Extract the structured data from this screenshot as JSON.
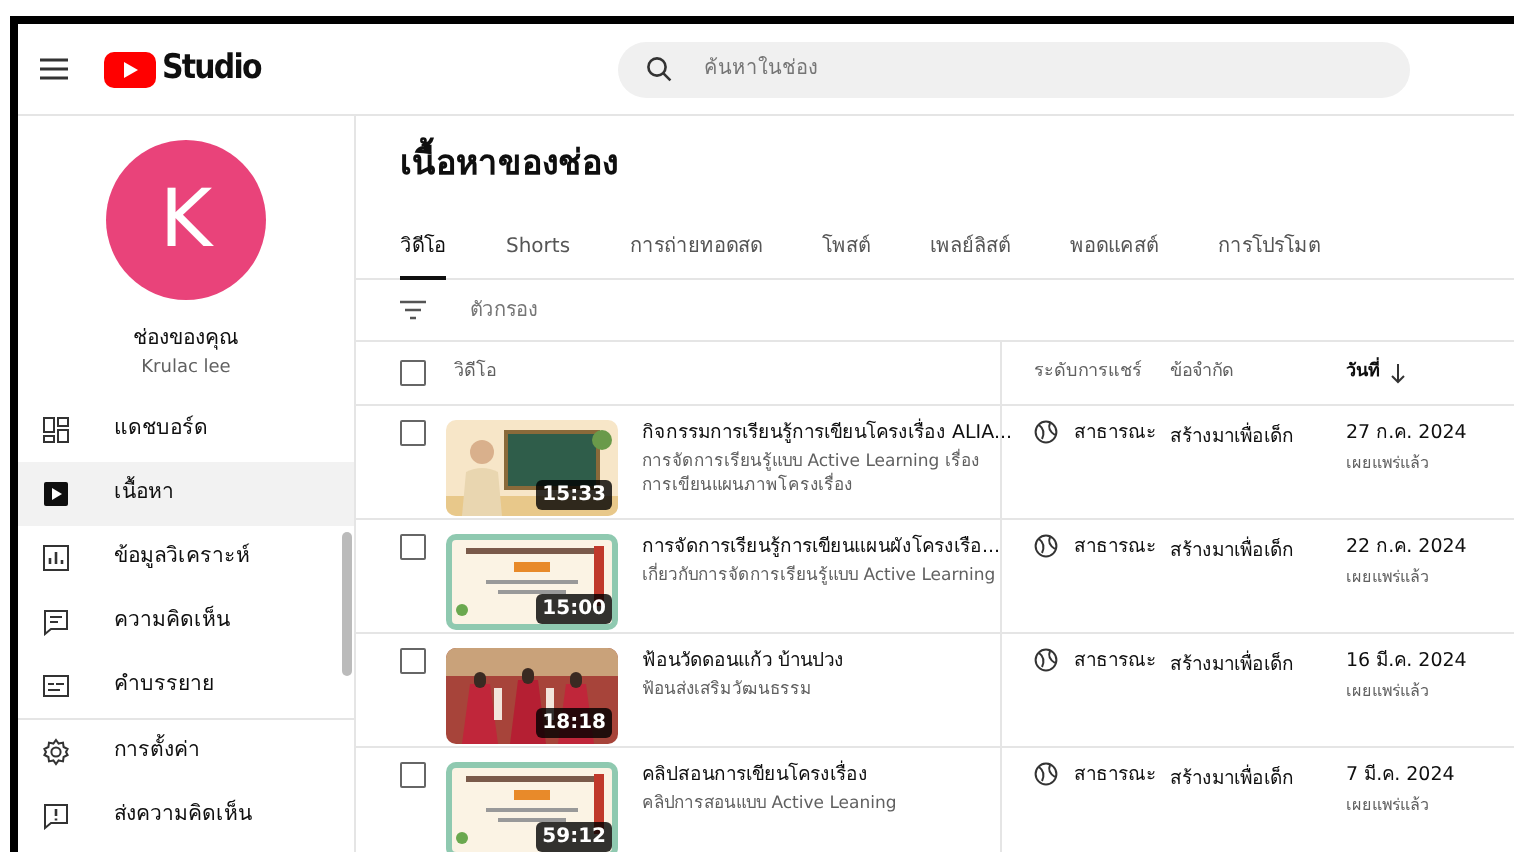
{
  "header": {
    "logo_text": "Studio",
    "search": {
      "placeholder": "ค้นหาในช่อง"
    }
  },
  "channel": {
    "avatar_letter": "K",
    "title": "ช่องของคุณ",
    "handle": "Krulac lee"
  },
  "sidebar": {
    "items": [
      {
        "label": "แดชบอร์ด",
        "selected": false
      },
      {
        "label": "เนื้อหา",
        "selected": true
      },
      {
        "label": "ข้อมูลวิเคราะห์",
        "selected": false
      },
      {
        "label": "ความคิดเห็น",
        "selected": false
      },
      {
        "label": "คำบรรยาย",
        "selected": false
      }
    ],
    "footer_items": [
      {
        "label": "การตั้งค่า"
      },
      {
        "label": "ส่งความคิดเห็น"
      }
    ]
  },
  "page_title": "เนื้อหาของช่อง",
  "tabs": [
    {
      "label": "วิดีโอ",
      "selected": true
    },
    {
      "label": "Shorts",
      "selected": false
    },
    {
      "label": "การถ่ายทอดสด",
      "selected": false
    },
    {
      "label": "โพสต์",
      "selected": false
    },
    {
      "label": "เพลย์ลิสต์",
      "selected": false
    },
    {
      "label": "พอดแคสต์",
      "selected": false
    },
    {
      "label": "การโปรโมต",
      "selected": false
    }
  ],
  "filter": {
    "placeholder": "ตัวกรอง"
  },
  "table": {
    "select_all_checked": false,
    "columns": [
      "วิดีโอ",
      "ระดับการแชร์",
      "ข้อจำกัด",
      "วันที่"
    ],
    "rows": [
      {
        "checked": false,
        "duration": "15:33",
        "title": "กิจกรรมการเรียนรู้การเขียนโครงเรื่อง ALIA...",
        "description": "การจัดการเรียนรู้แบบ Active Learning เรื่อง การเขียนแผนภาพโครงเรื่อง",
        "visibility": "สาธารณะ",
        "restriction": "สร้างมาเพื่อเด็ก",
        "date": "27 ก.ค. 2024",
        "status": "เผยแพร่แล้ว"
      },
      {
        "checked": false,
        "duration": "15:00",
        "title": "การจัดการเรียนรู้การเขียนแผนผังโครงเรือ...",
        "description": "เกี่ยวกับการจัดการเรียนรู้แบบ Active Learning",
        "visibility": "สาธารณะ",
        "restriction": "สร้างมาเพื่อเด็ก",
        "date": "22 ก.ค. 2024",
        "status": "เผยแพร่แล้ว"
      },
      {
        "checked": false,
        "duration": "18:18",
        "title": "ฟ้อนวัดดอนแก้ว บ้านปวง",
        "description": "ฟ้อนส่งเสริมวัฒนธรรม",
        "visibility": "สาธารณะ",
        "restriction": "สร้างมาเพื่อเด็ก",
        "date": "16 มี.ค. 2024",
        "status": "เผยแพร่แล้ว"
      },
      {
        "checked": false,
        "duration": "59:12",
        "title": "คลิปสอนการเขียนโครงเรื่อง",
        "description": "คลิปการสอนแบบ Active Leaning",
        "visibility": "สาธารณะ",
        "restriction": "สร้างมาเพื่อเด็ก",
        "date": "7 มี.ค. 2024",
        "status": "เผยแพร่แล้ว"
      }
    ]
  }
}
